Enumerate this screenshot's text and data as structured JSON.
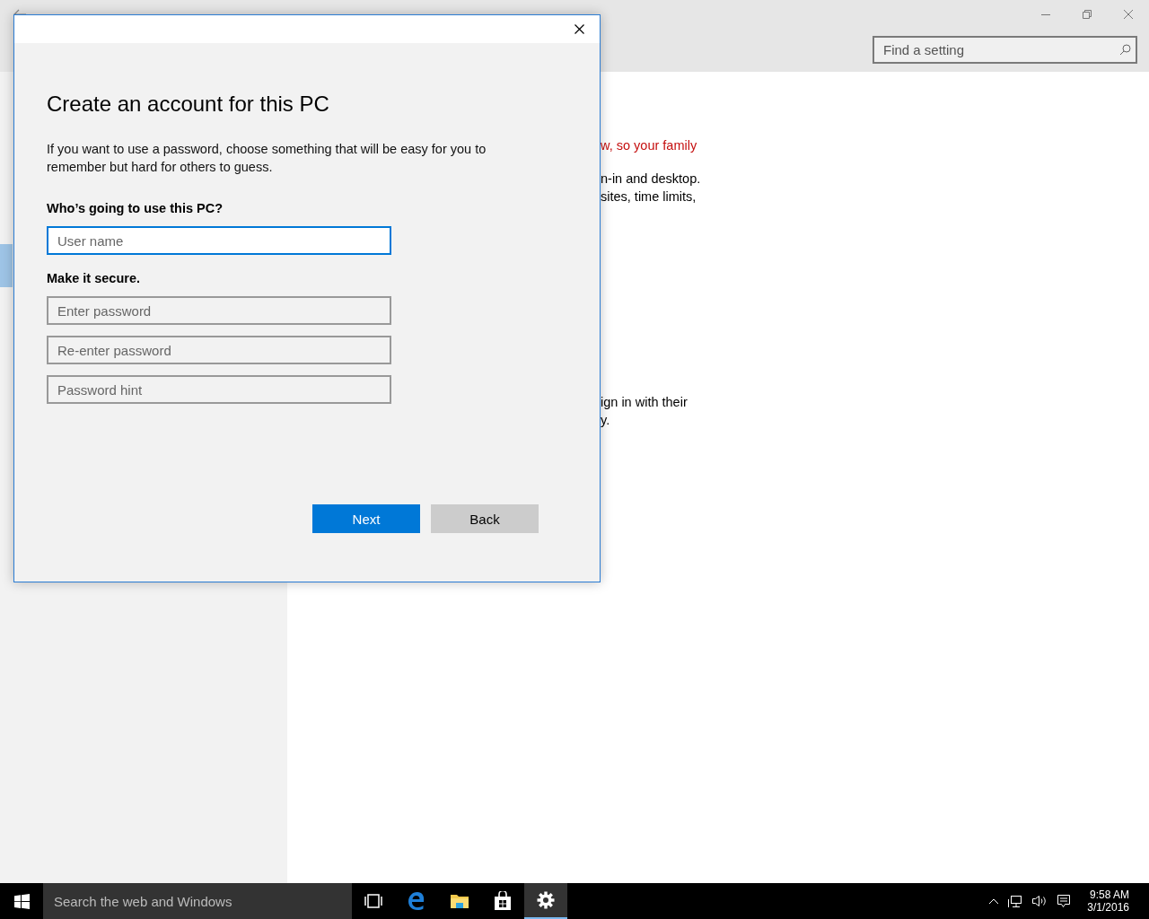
{
  "settings_window": {
    "search": {
      "placeholder": "Find a setting"
    },
    "sidebar": {
      "items": [
        {
          "selected": true
        }
      ]
    },
    "content": {
      "paragraphs": [
        {
          "kind": "warning",
          "lines": [
            "w, so your family"
          ]
        },
        {
          "kind": "normal",
          "lines": [
            "n-in and desktop.",
            "sites, time limits,"
          ]
        },
        {
          "kind": "normal",
          "lines": [
            "ign in with their",
            "y."
          ]
        }
      ]
    }
  },
  "dialog": {
    "heading": "Create an account for this PC",
    "description": "If you want to use a password, choose something that will be easy for you to remember but hard for others to guess.",
    "sections": [
      {
        "label": "Who’s going to use this PC?",
        "fields": [
          {
            "placeholder": "User name",
            "focused": true
          }
        ]
      },
      {
        "label": "Make it secure.",
        "fields": [
          {
            "placeholder": "Enter password",
            "focused": false
          },
          {
            "placeholder": "Re-enter password",
            "focused": false
          },
          {
            "placeholder": "Password hint",
            "focused": false
          }
        ]
      }
    ],
    "buttons": [
      {
        "label": "Next",
        "kind": "primary"
      },
      {
        "label": "Back",
        "kind": "secondary"
      }
    ]
  },
  "taskbar": {
    "search": {
      "placeholder": "Search the web and Windows"
    },
    "apps": [
      {
        "kind": "task-view",
        "active": false
      },
      {
        "kind": "browser",
        "active": false
      },
      {
        "kind": "folder",
        "active": false
      },
      {
        "kind": "store",
        "active": false
      },
      {
        "kind": "settings",
        "active": true
      }
    ],
    "clock": {
      "time": "9:58 AM",
      "date": "3/1/2016"
    }
  }
}
